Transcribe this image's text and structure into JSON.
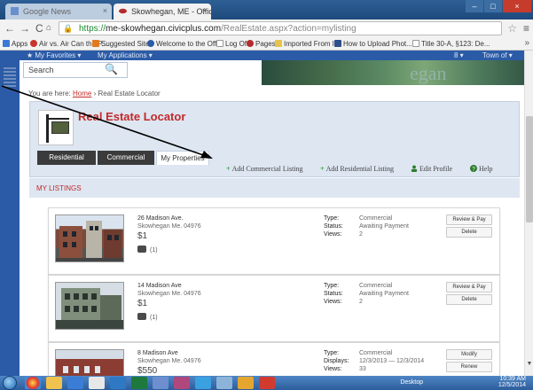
{
  "browser": {
    "tabs": [
      {
        "title": "Google News"
      },
      {
        "title": "Skowhegan, ME - Official"
      }
    ],
    "url_scheme": "https://",
    "url_host": "me-skowhegan.civicplus.com",
    "url_path": "/RealEstate.aspx?action=mylisting",
    "bookmarks": [
      {
        "label": "Apps",
        "color": "#3a79d8"
      },
      {
        "label": "Air vs. Air Can the P...",
        "color": "#c8352a"
      },
      {
        "label": "Suggested Sites",
        "color": "#e07a1e"
      },
      {
        "label": "Welcome to the Offi...",
        "color": "#2b5ba6"
      },
      {
        "label": "Log Off",
        "color": "#d9d9d9"
      },
      {
        "label": "Pages",
        "color": "#2b5ba6"
      },
      {
        "label": "Imported From IE",
        "color": "#e6c34a"
      },
      {
        "label": "How to Upload Phot...",
        "color": "#2f4f8a"
      },
      {
        "label": "Title 30-A, §123: De...",
        "color": "#d9d9d9"
      }
    ],
    "bookmarks_more": "»"
  },
  "site": {
    "nav": {
      "favorites": "★   My Favorites ▾",
      "applications": "My Applications ▾",
      "num": "8 ▾",
      "town": "Town of ▾"
    },
    "search_placeholder": "Search",
    "banner_word": "egan"
  },
  "page": {
    "breadcrumb_prefix": "You are here:",
    "breadcrumb_home": "Home",
    "breadcrumb_rest": "› Real Estate Locator",
    "title": "Real Estate Locator",
    "tabs": [
      "Residential",
      "Commercial",
      "My Properties"
    ],
    "actions": {
      "add_commercial": "Add Commercial Listing",
      "add_residential": "Add Residential Listing",
      "edit_profile": "Edit Profile",
      "help": "Help"
    },
    "listings_header": "MY LISTINGS",
    "listings": [
      {
        "address": "26 Madison Ave.",
        "city": "Skowhegan Me. 04976",
        "price": "$1",
        "photos": "(1)",
        "meta": [
          {
            "k": "Type:",
            "v": "Commercial"
          },
          {
            "k": "Status:",
            "v": "Awaiting Payment"
          },
          {
            "k": "Views:",
            "v": "2"
          }
        ],
        "buttons": [
          "Review & Pay",
          "Delete"
        ]
      },
      {
        "address": "14 Madison Ave",
        "city": "Skowhegan Me. 04976",
        "price": "$1",
        "photos": "(1)",
        "meta": [
          {
            "k": "Type:",
            "v": "Commercial"
          },
          {
            "k": "Status:",
            "v": "Awaiting Payment"
          },
          {
            "k": "Views:",
            "v": "2"
          }
        ],
        "buttons": [
          "Review & Pay",
          "Delete"
        ]
      },
      {
        "address": "8 Madison Ave",
        "city": "Skowhegan Me. 04976",
        "price": "$550",
        "photos": "",
        "meta": [
          {
            "k": "Type:",
            "v": "Commercial"
          },
          {
            "k": "Displays:",
            "v": "12/3/2013 — 12/3/2014"
          },
          {
            "k": "Views:",
            "v": "33"
          }
        ],
        "buttons": [
          "Modify",
          "Renew"
        ]
      }
    ]
  },
  "taskbar": {
    "desktop_label": "Desktop",
    "time": "10:39 AM",
    "date": "12/5/2014"
  }
}
